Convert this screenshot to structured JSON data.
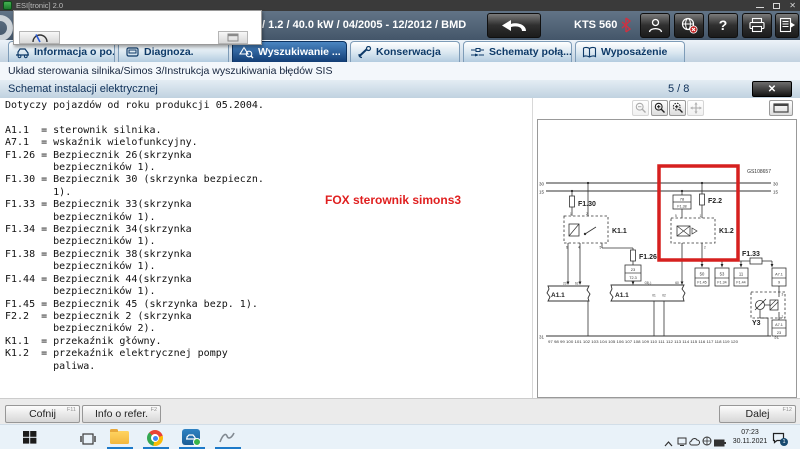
{
  "window": {
    "title": "ESI[tronic] 2.0"
  },
  "toolbar": {
    "vehicle_info": "/ 1.2 / 40.0 kW / 04/2005 - 12/2012 / BMD",
    "device_label": "KTS 560",
    "help_label": "?"
  },
  "tabs": [
    {
      "label": "Informacja o po...",
      "active": false
    },
    {
      "label": "Diagnoza.",
      "active": false
    },
    {
      "label": "Wyszukiwanie ...",
      "active": true
    },
    {
      "label": "Konserwacja",
      "active": false
    },
    {
      "label": "Schematy połą...",
      "active": false
    },
    {
      "label": "Wyposażenie",
      "active": false
    }
  ],
  "breadcrumb": "Układ sterowania silnika/Simos 3/Instrukcja wyszukiwania błędów SIS",
  "panel": {
    "title": "Schemat instalacji elektrycznej",
    "page_indicator": "5 / 8",
    "close_label": "✕"
  },
  "legend": {
    "text": "Dotyczy pojazdów od roku produkcji 05.2004.\n\nA1.1  = sterownik silnika.\nA7.1  = wskaźnik wielofunkcyjny.\nF1.26 = Bezpiecznik 26(skrzynka\n        bezpieczników 1).\nF1.30 = Bezpiecznik 30 (skrzynka bezpieczn.\n        1).\nF1.33 = Bezpiecznik 33(skrzynka\n        bezpieczników 1).\nF1.34 = Bezpiecznik 34(skrzynka\n        bezpieczników 1).\nF1.38 = Bezpiecznik 38(skrzynka\n        bezpieczników 1).\nF1.44 = Bezpiecznik 44(skrzynka\n        bezpieczników 1).\nF1.45 = Bezpiecznik 45 (skrzynka bezp. 1).\nF2.2  = bezpiecznik 2 (skrzynka\n        bezpieczników 2).\nK1.1  = przekaźnik główny.\nK1.2  = przekaźnik elektrycznej pompy\n        paliwa."
  },
  "annotation": {
    "text": "FOX sterownik simons3",
    "color": "#e01f1f"
  },
  "diagram": {
    "ref": "GS108657",
    "bus_30": "30",
    "bus_15": "15",
    "ground_31": "31",
    "ticks": "97 98 99 100 101 102 103 104 105 106 107 108 109 110 111 112 113 114 115 116 117 118 119 120",
    "f130": "F1.30",
    "k11": "K1.1",
    "k11_pins": {
      "p1": "1",
      "p2": "2",
      "p6": "6",
      "p4": "4",
      "p5": "5"
    },
    "box78": {
      "top": "78",
      "bottom": "F1.38"
    },
    "f22": "F2.2",
    "k12": "K1.2",
    "k12_pins": {
      "p5": "5",
      "p1": "1",
      "p2": "2"
    },
    "f126": "F1.26",
    "box23": {
      "top": "23",
      "bottom": "T2.3"
    },
    "a11_left": "A1.1",
    "a11_left_pins": {
      "p23": "23",
      "p62": "62"
    },
    "a11_center": "A1.1",
    "a11_center_pins": {
      "p03": "03(-)",
      "p60": "60",
      "p01": "01",
      "p02": "02"
    },
    "fuse_boxes": [
      {
        "top": "50",
        "bottom": "F1.45"
      },
      {
        "top": "53",
        "bottom": "F1.34"
      },
      {
        "top": "11",
        "bottom": "F1.44"
      }
    ],
    "f133": "F1.33",
    "a71_9": {
      "top": "A7.1",
      "bottom": "9"
    },
    "y3": "Y3",
    "y3_pins": {
      "p3": "3",
      "p2": "2"
    },
    "a71_23": {
      "top": "A7.1",
      "bottom": "23"
    },
    "highlight_color": "#d6201f"
  },
  "footer": {
    "back": {
      "label": "Cofnij",
      "key": "F11"
    },
    "info": {
      "label": "Info o refer.",
      "key": "F2"
    },
    "next": {
      "label": "Dalej",
      "key": "F12"
    }
  },
  "taskbar": {
    "clock_time": "07:23",
    "clock_date": "30.11.2021",
    "notification_count": "1"
  },
  "colors": {
    "taskbar_accent": "#1d7ac9",
    "toolbar_bg": "#51647a"
  }
}
